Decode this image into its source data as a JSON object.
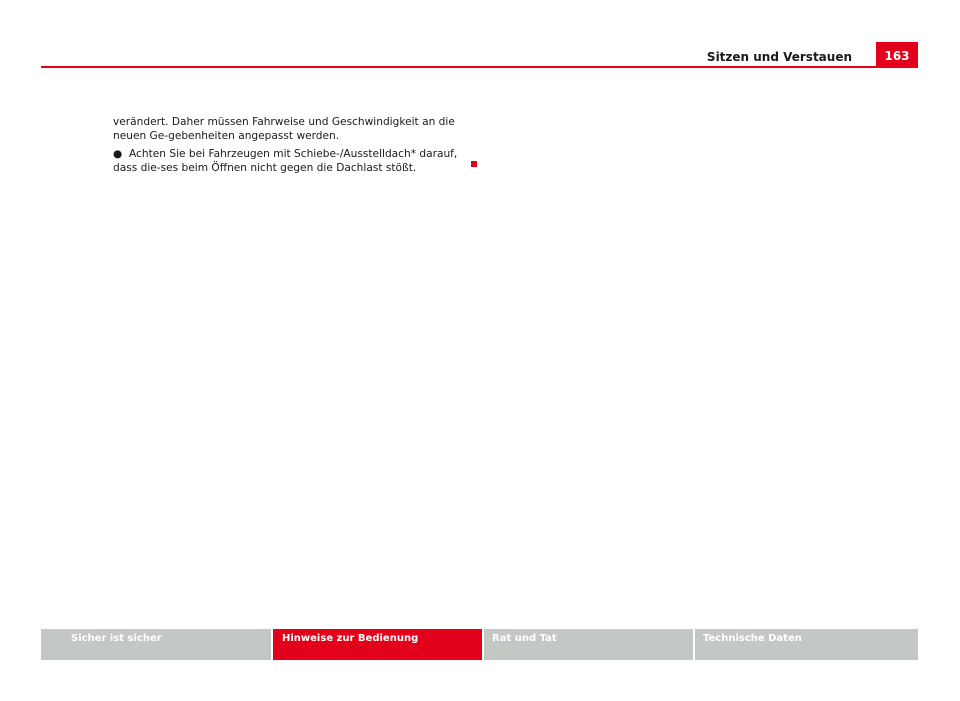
{
  "header": {
    "section_title": "Sitzen und Verstauen",
    "page_number": "163"
  },
  "content": {
    "paragraph": "verändert. Daher müssen Fahrweise und Geschwindigkeit an die neuen Ge-gebenheiten angepasst werden.",
    "bullet_symbol": "●",
    "bullet_text": "Achten Sie bei Fahrzeugen mit Schiebe-/Ausstelldach* darauf, dass die-ses beim Öffnen nicht gegen die Dachlast stößt."
  },
  "footer": {
    "tabs": [
      {
        "label": "Sicher ist sicher",
        "active": false
      },
      {
        "label": "Hinweise zur Bedienung",
        "active": true
      },
      {
        "label": "Rat und Tat",
        "active": false
      },
      {
        "label": "Technische Daten",
        "active": false
      }
    ]
  },
  "colors": {
    "accent": "#e3001b",
    "tab_inactive": "#c4c8c5"
  }
}
